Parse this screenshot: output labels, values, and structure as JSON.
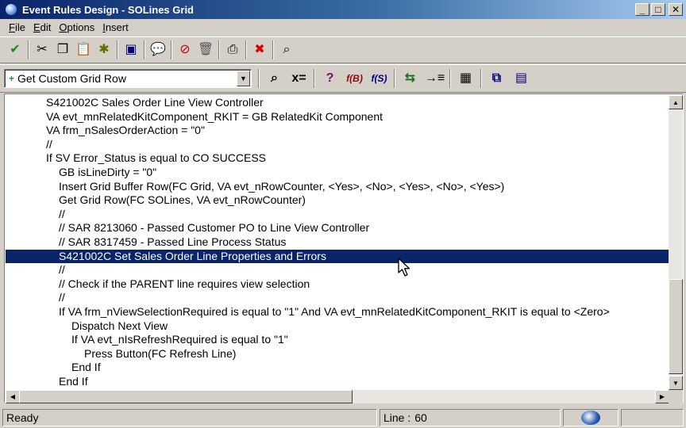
{
  "window": {
    "title": "Event Rules Design - SOLines Grid",
    "controls": [
      "_",
      "□",
      "✕"
    ]
  },
  "menu": [
    {
      "label": "File",
      "accel": "F",
      "rest": "ile"
    },
    {
      "label": "Edit",
      "accel": "E",
      "rest": "dit"
    },
    {
      "label": "Options",
      "accel": "O",
      "rest": "ptions"
    },
    {
      "label": "Insert",
      "accel": "I",
      "rest": "nsert"
    }
  ],
  "toolbar1": [
    {
      "name": "ok-check-icon",
      "glyph": "✔",
      "color": "#1a8a1a"
    },
    {
      "name": "cut-icon",
      "glyph": "✂",
      "color": "#000000"
    },
    {
      "name": "copy-icon",
      "glyph": "❐",
      "color": "#000000"
    },
    {
      "name": "paste-icon",
      "glyph": "📋",
      "color": "#8a6a00"
    },
    {
      "name": "paste-special-icon",
      "glyph": "✱",
      "color": "#6a6a00"
    },
    {
      "name": "save-icon",
      "glyph": "▣",
      "color": "#000080"
    },
    {
      "name": "comment-icon",
      "glyph": "💬",
      "color": "#000000"
    },
    {
      "name": "disable-icon",
      "glyph": "⊘",
      "color": "#cc0000"
    },
    {
      "name": "trash-icon",
      "glyph": "🗑",
      "color": "#555555"
    },
    {
      "name": "print-icon",
      "glyph": "⎙",
      "color": "#000000"
    },
    {
      "name": "cancel-x-icon",
      "glyph": "✖",
      "color": "#dd0000"
    },
    {
      "name": "search-icon",
      "glyph": "⌕",
      "color": "#000000"
    }
  ],
  "toolbar1_seps_after": [
    0,
    4,
    5,
    6,
    8,
    9,
    10
  ],
  "event_combo": {
    "value": "Get Custom Grid Row"
  },
  "toolbar2": [
    {
      "name": "find-icon",
      "glyph": "⌕",
      "color": "#000000"
    },
    {
      "name": "assignment-icon",
      "glyph": "x=",
      "color": "#000000"
    },
    {
      "name": "if-icon",
      "glyph": "?",
      "color": "#7a0a7a"
    },
    {
      "name": "business-function-icon",
      "glyph": "f(B)",
      "color": "#8a0a0a"
    },
    {
      "name": "system-function-icon",
      "glyph": "f(S)",
      "color": "#000080"
    },
    {
      "name": "table-io-icon",
      "glyph": "⇆",
      "color": "#1a6a1a"
    },
    {
      "name": "insert-line-icon",
      "glyph": "→≡",
      "color": "#000000"
    },
    {
      "name": "variables-icon",
      "glyph": "▦",
      "color": "#000000"
    },
    {
      "name": "form-interconnect-icon",
      "glyph": "⧉",
      "color": "#000080"
    },
    {
      "name": "report-interconnect-icon",
      "glyph": "▤",
      "color": "#000080"
    }
  ],
  "code_lines": [
    {
      "indent": 3,
      "text": "S421002C Sales Order Line View Controller",
      "selected": false
    },
    {
      "indent": 3,
      "text": "VA evt_mnRelatedKitComponent_RKIT = GB RelatedKit Component",
      "selected": false
    },
    {
      "indent": 3,
      "text": "VA frm_nSalesOrderAction = \"0\"",
      "selected": false
    },
    {
      "indent": 3,
      "text": "//",
      "selected": false
    },
    {
      "indent": 3,
      "text": "If SV Error_Status is equal to CO SUCCESS",
      "selected": false
    },
    {
      "indent": 4,
      "text": "GB isLineDirty = \"0\"",
      "selected": false
    },
    {
      "indent": 4,
      "text": "Insert Grid Buffer Row(FC Grid, VA evt_nRowCounter, <Yes>, <No>, <Yes>, <No>, <Yes>)",
      "selected": false
    },
    {
      "indent": 4,
      "text": "Get Grid Row(FC SOLines, VA evt_nRowCounter)",
      "selected": false
    },
    {
      "indent": 4,
      "text": "//",
      "selected": false
    },
    {
      "indent": 4,
      "text": "// SAR 8213060 - Passed Customer PO to Line View Controller",
      "selected": false
    },
    {
      "indent": 4,
      "text": "// SAR 8317459 - Passed Line Process Status",
      "selected": false
    },
    {
      "indent": 4,
      "text": "S421002C Set Sales Order Line Properties and Errors",
      "selected": true
    },
    {
      "indent": 4,
      "text": "//",
      "selected": false
    },
    {
      "indent": 4,
      "text": "// Check if the PARENT line requires view selection",
      "selected": false
    },
    {
      "indent": 4,
      "text": "//",
      "selected": false
    },
    {
      "indent": 4,
      "text": "If VA frm_nViewSelectionRequired is equal to \"1\" And VA evt_mnRelatedKitComponent_RKIT is equal to <Zero>",
      "selected": false
    },
    {
      "indent": 5,
      "text": "Dispatch Next View",
      "selected": false
    },
    {
      "indent": 5,
      "text": "If VA evt_nIsRefreshRequired is equal to \"1\"",
      "selected": false
    },
    {
      "indent": 6,
      "text": "Press Button(FC Refresh Line)",
      "selected": false
    },
    {
      "indent": 5,
      "text": "End If",
      "selected": false
    },
    {
      "indent": 4,
      "text": "End If",
      "selected": false
    }
  ],
  "status": {
    "text": "Ready",
    "line_label": "Line :",
    "line_number": "60"
  },
  "colors": {
    "selection": "#0a246a",
    "window_face": "#d4d0c8"
  }
}
